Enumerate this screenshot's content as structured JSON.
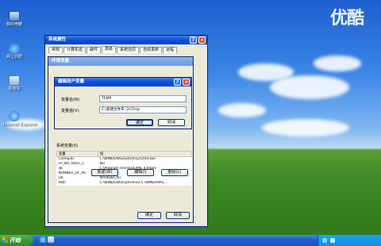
{
  "brand_logo_text": "优酷",
  "desktop_icons": [
    {
      "label": "我的电脑",
      "icon": "my-computer-icon"
    },
    {
      "label": "网上邻居",
      "icon": "network-places-icon"
    },
    {
      "label": "回收站",
      "icon": "recycle-bin-icon"
    },
    {
      "label": "Internet Explorer",
      "icon": "ie-icon"
    }
  ],
  "sys_props": {
    "title": "系统属性",
    "tabs": [
      "常规",
      "计算机名",
      "硬件",
      "高级",
      "系统还原",
      "自动更新",
      "远程"
    ],
    "active_tab": "高级",
    "help_glyph": "?",
    "close_glyph": "×"
  },
  "env_vars": {
    "title": "环境变量",
    "system_vars_label": "系统变量(S)",
    "columns": [
      "变量",
      "值"
    ],
    "rows": [
      {
        "name": "ComSpec",
        "value": "C:\\WINDOWS\\system32\\cmd.exe"
      },
      {
        "name": "FP_NO_HOST_C",
        "value": "NO"
      },
      {
        "name": "lib",
        "value": "C:\\Program Files\\SQLXML 4.0\\bin\\"
      },
      {
        "name": "NUMBER_OF_PR",
        "value": "1"
      },
      {
        "name": "OS",
        "value": "Windows_NT"
      },
      {
        "name": "Path",
        "value": "C:\\WINDOWS\\system32;C:\\WINDOWS;..."
      }
    ],
    "new_label": "新建(W)",
    "edit_label": "编辑(I)",
    "delete_label": "删除(L)",
    "ok_label": "确定",
    "cancel_label": "取消"
  },
  "edit_dialog": {
    "title": "编辑用户变量",
    "name_label": "变量名(N):",
    "name_value": "TEMP",
    "value_label": "变量值(V):",
    "value_value": "C:\\新建文件夹 (2)\\Tmp",
    "ok_label": "确定",
    "cancel_label": "取消"
  },
  "taskbar": {
    "start_label": "开始"
  },
  "colors": {
    "title_blue": "#0a4fd6",
    "close_red": "#e04a2a",
    "start_green": "#3c9a34",
    "dialog_face": "#ece9d8"
  }
}
